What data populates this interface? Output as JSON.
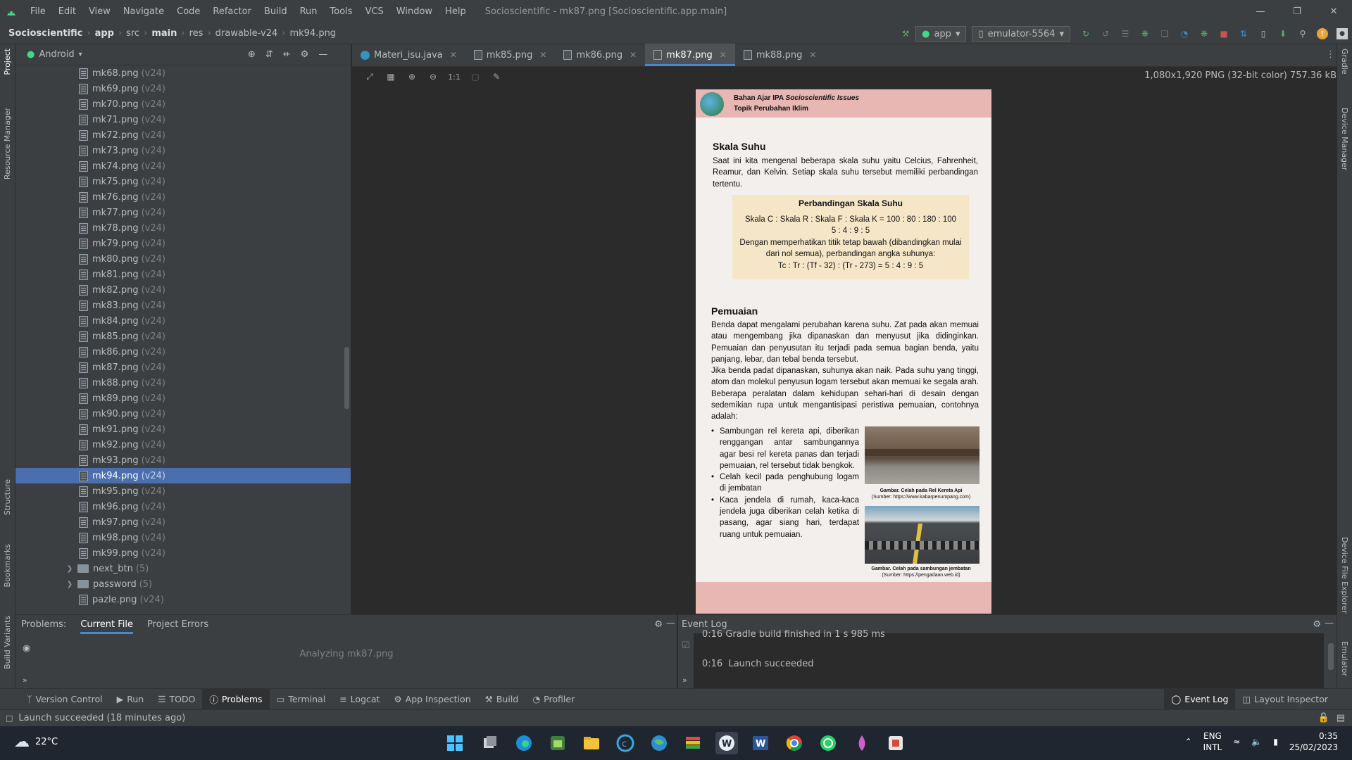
{
  "titlebar": {
    "menu": [
      "File",
      "Edit",
      "View",
      "Navigate",
      "Code",
      "Refactor",
      "Build",
      "Run",
      "Tools",
      "VCS",
      "Window",
      "Help"
    ],
    "title": "Socioscientific - mk87.png [Socioscientific.app.main]"
  },
  "navbar": {
    "crumbs": [
      "Socioscientific",
      "app",
      "src",
      "main",
      "res",
      "drawable-v24",
      "mk94.png"
    ],
    "run_config": "app",
    "device": "emulator-5564"
  },
  "left_stripe": {
    "project": "Project",
    "resource_manager": "Resource Manager",
    "structure": "Structure",
    "bookmarks": "Bookmarks",
    "build_variants": "Build Variants"
  },
  "right_stripe": {
    "gradle": "Gradle",
    "device_manager": "Device Manager",
    "device_file_explorer": "Device File Explorer",
    "emulator": "Emulator"
  },
  "project_panel": {
    "view_mode": "Android",
    "files": [
      {
        "name": "mk68.png",
        "v": "(v24)"
      },
      {
        "name": "mk69.png",
        "v": "(v24)"
      },
      {
        "name": "mk70.png",
        "v": "(v24)"
      },
      {
        "name": "mk71.png",
        "v": "(v24)"
      },
      {
        "name": "mk72.png",
        "v": "(v24)"
      },
      {
        "name": "mk73.png",
        "v": "(v24)"
      },
      {
        "name": "mk74.png",
        "v": "(v24)"
      },
      {
        "name": "mk75.png",
        "v": "(v24)"
      },
      {
        "name": "mk76.png",
        "v": "(v24)"
      },
      {
        "name": "mk77.png",
        "v": "(v24)"
      },
      {
        "name": "mk78.png",
        "v": "(v24)"
      },
      {
        "name": "mk79.png",
        "v": "(v24)"
      },
      {
        "name": "mk80.png",
        "v": "(v24)"
      },
      {
        "name": "mk81.png",
        "v": "(v24)"
      },
      {
        "name": "mk82.png",
        "v": "(v24)"
      },
      {
        "name": "mk83.png",
        "v": "(v24)"
      },
      {
        "name": "mk84.png",
        "v": "(v24)"
      },
      {
        "name": "mk85.png",
        "v": "(v24)"
      },
      {
        "name": "mk86.png",
        "v": "(v24)"
      },
      {
        "name": "mk87.png",
        "v": "(v24)"
      },
      {
        "name": "mk88.png",
        "v": "(v24)"
      },
      {
        "name": "mk89.png",
        "v": "(v24)"
      },
      {
        "name": "mk90.png",
        "v": "(v24)"
      },
      {
        "name": "mk91.png",
        "v": "(v24)"
      },
      {
        "name": "mk92.png",
        "v": "(v24)"
      },
      {
        "name": "mk93.png",
        "v": "(v24)"
      },
      {
        "name": "mk94.png",
        "v": "(v24)",
        "selected": true
      },
      {
        "name": "mk95.png",
        "v": "(v24)"
      },
      {
        "name": "mk96.png",
        "v": "(v24)"
      },
      {
        "name": "mk97.png",
        "v": "(v24)"
      },
      {
        "name": "mk98.png",
        "v": "(v24)"
      },
      {
        "name": "mk99.png",
        "v": "(v24)"
      },
      {
        "name": "next_btn",
        "v": "(5)",
        "folder": true
      },
      {
        "name": "password",
        "v": "(5)",
        "folder": true
      },
      {
        "name": "pazle.png",
        "v": "(v24)"
      }
    ]
  },
  "editor_tabs": [
    {
      "label": "Materi_isu.java",
      "kind": "java"
    },
    {
      "label": "mk85.png",
      "kind": "png"
    },
    {
      "label": "mk86.png",
      "kind": "png"
    },
    {
      "label": "mk87.png",
      "kind": "png",
      "active": true
    },
    {
      "label": "mk88.png",
      "kind": "png"
    }
  ],
  "image_info": "1,080x1,920 PNG (32-bit color) 757.36 kB",
  "zoom_actual": "1:1",
  "doc": {
    "header_line1_a": "Bahan Ajar IPA ",
    "header_line1_b": "Socioscientific Issues",
    "header_line2": "Topik Perubahan Iklim",
    "h1": "Skala Suhu",
    "p1": "Saat ini kita mengenal beberapa skala suhu yaitu Celcius, Fahrenheit, Reamur, dan Kelvin. Setiap skala suhu tersebut memiliki perbandingan tertentu.",
    "box_title": "Perbandingan Skala Suhu",
    "box_line1": "Skala C : Skala R : Skala F : Skala K = 100 : 80 : 180 : 100",
    "box_line2": "5 : 4 : 9 : 5",
    "box_line3": "Dengan memperhatikan titik tetap bawah (dibandingkan mulai dari nol semua), perbandingan angka suhunya:",
    "box_line4": "Tc : Tr : (Tf - 32) : (Tr - 273) = 5 : 4 : 9 : 5",
    "h2": "Pemuaian",
    "p2": "Benda dapat mengalami perubahan karena suhu. Zat pada akan memuai atau mengembang jika dipanaskan dan menyusut jika didinginkan. Pemuaian dan penyusutan itu terjadi pada semua bagian benda, yaitu panjang, lebar, dan tebal benda tersebut.",
    "p3": "Jika benda padat dipanaskan, suhunya akan naik. Pada suhu yang tinggi, atom dan molekul penyusun logam tersebut akan memuai ke segala arah. Beberapa peralatan dalam kehidupan sehari-hari di desain dengan sedemikian rupa untuk mengantisipasi peristiwa pemuaian, contohnya adalah:",
    "bullets": [
      "Sambungan rel kereta api, diberikan renggangan antar sambungannya agar besi rel kereta panas dan terjadi pemuaian, rel tersebut tidak bengkok.",
      "Celah kecil pada penghubung logam di jembatan",
      "Kaca jendela di rumah, kaca-kaca jendela juga diberikan celah ketika di pasang, agar siang hari, terdapat ruang untuk pemuaian."
    ],
    "cap1_title": "Gambar. Celah pada Rel Kereta Api",
    "cap1_src": "(Sumber: https://www.kabarpenumpang.com)",
    "cap2_title": "Gambar. Celah pada sambungan jembatan",
    "cap2_src": "(Sumber: https://pengadaan.web.id)"
  },
  "problems": {
    "label": "Problems:",
    "tabs": [
      "Current File",
      "Project Errors"
    ],
    "status": "Analyzing mk87.png"
  },
  "event_log": {
    "title": "Event Log",
    "line0": "0:16  Gradle build finished in 1 s 985 ms",
    "line1_time": "0:16",
    "line1_msg": "Launch succeeded"
  },
  "tool_windows": {
    "left": [
      "Version Control",
      "Run",
      "TODO",
      "Problems",
      "Terminal",
      "Logcat",
      "App Inspection",
      "Build",
      "Profiler"
    ],
    "right": [
      "Event Log",
      "Layout Inspector"
    ]
  },
  "status_text": "Launch succeeded (18 minutes ago)",
  "taskbar": {
    "weather": "22°C",
    "lang1": "ENG",
    "lang2": "INTL",
    "time": "0:35",
    "date": "25/02/2023"
  }
}
